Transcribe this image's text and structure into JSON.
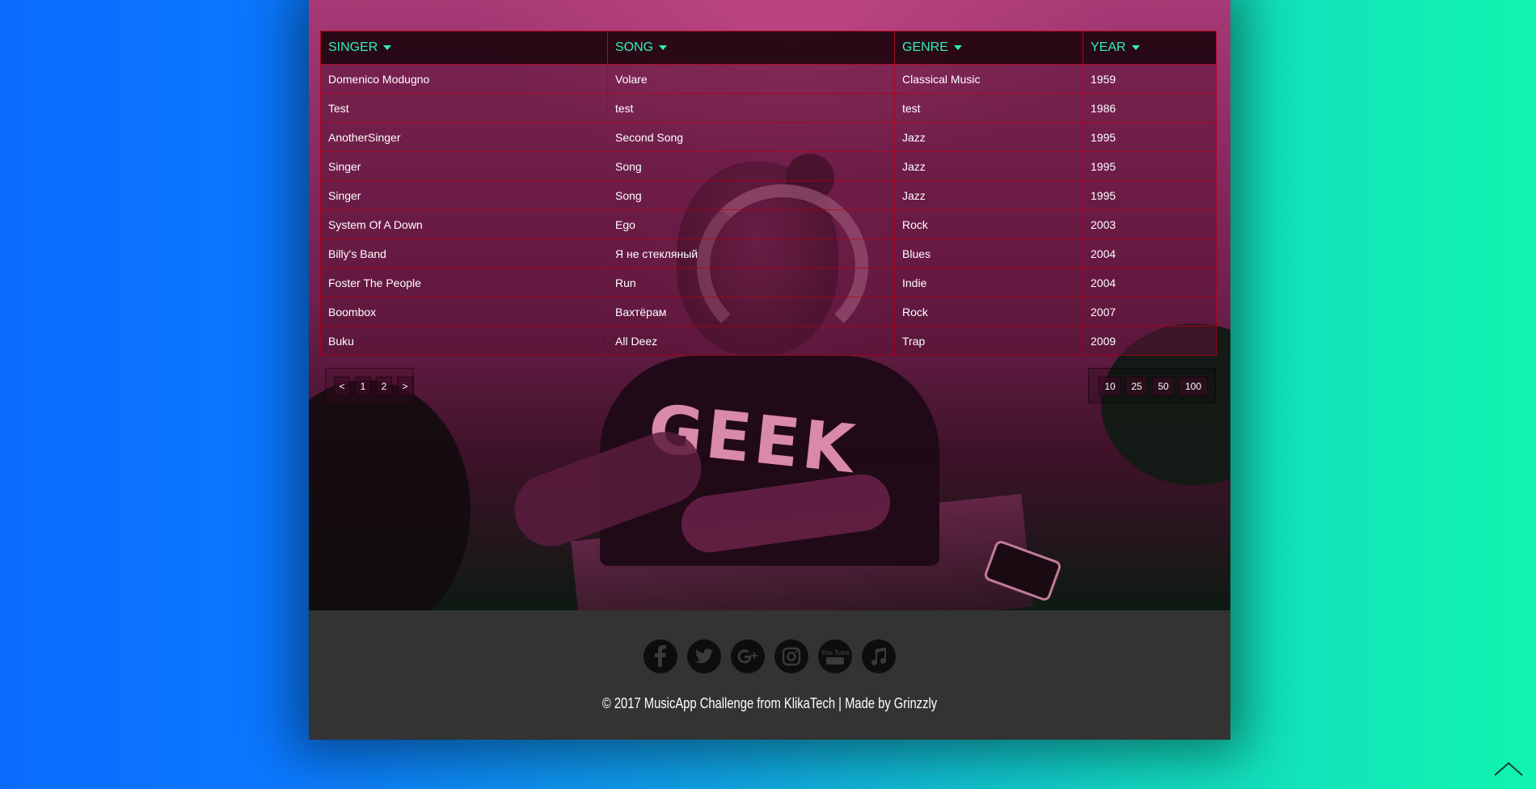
{
  "table": {
    "headers": {
      "singer": "SINGER",
      "song": "SONG",
      "genre": "GENRE",
      "year": "YEAR"
    },
    "rows": [
      {
        "singer": "Domenico Modugno",
        "song": "Volare",
        "genre": "Classical Music",
        "year": "1959"
      },
      {
        "singer": "Test",
        "song": "test",
        "genre": "test",
        "year": "1986"
      },
      {
        "singer": "AnotherSinger",
        "song": "Second Song",
        "genre": "Jazz",
        "year": "1995"
      },
      {
        "singer": "Singer",
        "song": "Song",
        "genre": "Jazz",
        "year": "1995"
      },
      {
        "singer": "Singer",
        "song": "Song",
        "genre": "Jazz",
        "year": "1995"
      },
      {
        "singer": "System Of A Down",
        "song": "Ego",
        "genre": "Rock",
        "year": "2003"
      },
      {
        "singer": "Billy's Band",
        "song": "Я не стекляный",
        "genre": "Blues",
        "year": "2004"
      },
      {
        "singer": "Foster The People",
        "song": "Run",
        "genre": "Indie",
        "year": "2004"
      },
      {
        "singer": "Boombox",
        "song": "Вахтёрам",
        "genre": "Rock",
        "year": "2007"
      },
      {
        "singer": "Buku",
        "song": "All Deez",
        "genre": "Trap",
        "year": "2009"
      }
    ]
  },
  "pagination": {
    "prev": "<",
    "pages": [
      "1",
      "2"
    ],
    "next": ">"
  },
  "page_sizes": [
    "10",
    "25",
    "50",
    "100"
  ],
  "hero_image": {
    "shirt_text": "GEEK"
  },
  "footer": {
    "social_icons": [
      "facebook-icon",
      "twitter-icon",
      "google-plus-icon",
      "instagram-icon",
      "youtube-icon",
      "music-note-icon"
    ],
    "youtube_label": "You Tube",
    "copyright": "© 2017 MusicApp Challenge from KlikaTech | Made by Grinzzly"
  },
  "colors": {
    "header_text": "#2ef0b4",
    "footer_bg": "#333333",
    "grid_line": "#aa0014"
  },
  "scroll_top_icon": "chevron-up-icon"
}
